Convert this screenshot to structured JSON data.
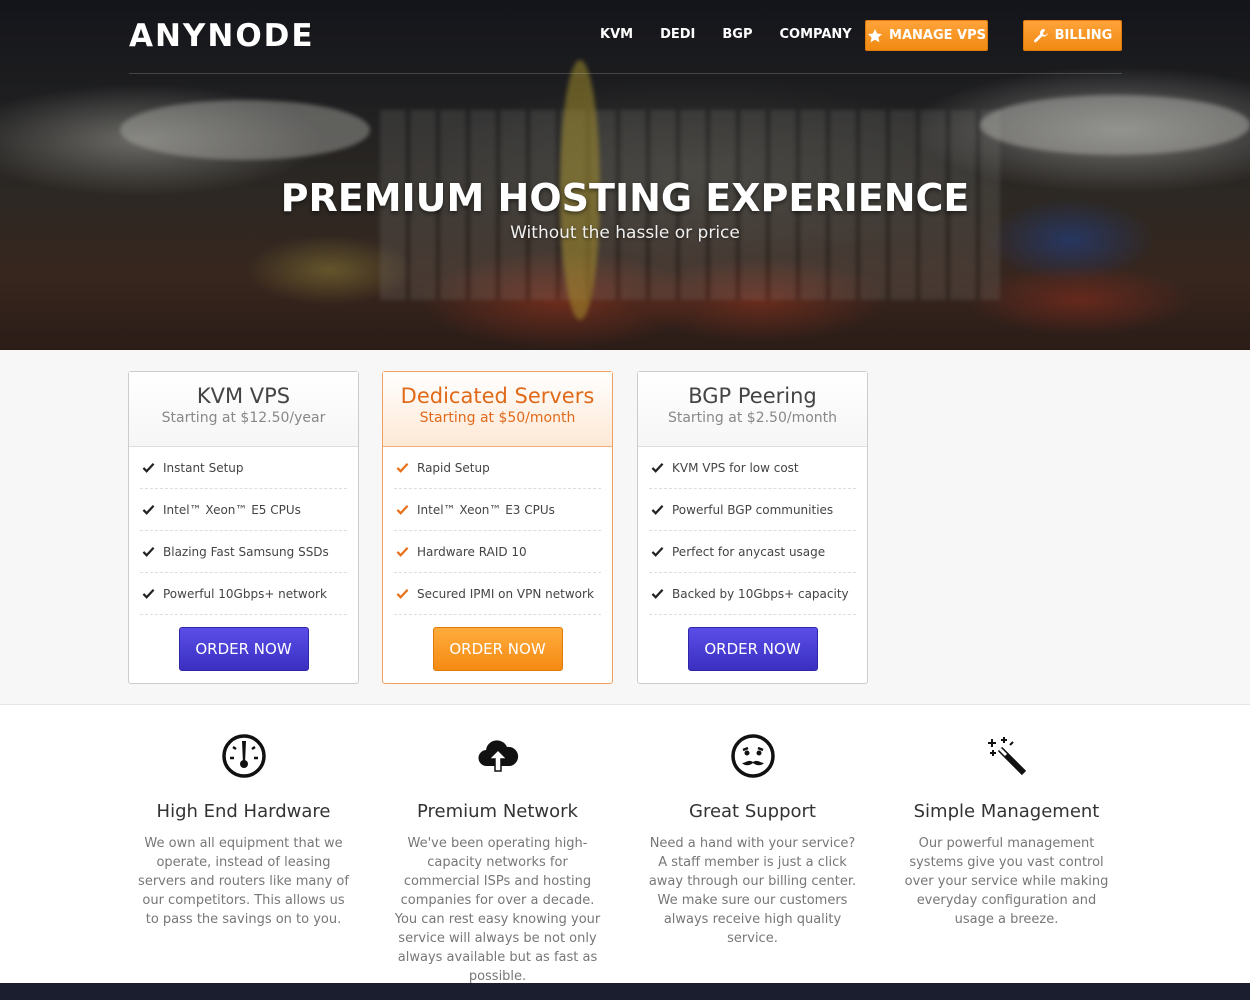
{
  "header": {
    "logo": "ANYNODE",
    "nav": [
      "KVM",
      "DEDI",
      "BGP",
      "COMPANY"
    ],
    "manage_vps_label": "MANAGE VPS",
    "billing_label": "BILLING"
  },
  "hero": {
    "title": "PREMIUM HOSTING EXPERIENCE",
    "subtitle": "Without the hassle or price"
  },
  "plans": [
    {
      "name": "KVM VPS",
      "price": "Starting at $12.50/year",
      "features": [
        "Instant Setup",
        "Intel™ Xeon™ E5 CPUs",
        "Blazing Fast Samsung SSDs",
        "Powerful 10Gbps+ network"
      ],
      "cta": "ORDER NOW"
    },
    {
      "name": "Dedicated Servers",
      "price": "Starting at $50/month",
      "features": [
        "Rapid Setup",
        "Intel™ Xeon™ E3 CPUs",
        "Hardware RAID 10",
        "Secured IPMI on VPN network"
      ],
      "cta": "ORDER NOW"
    },
    {
      "name": "BGP Peering",
      "price": "Starting at $2.50/month",
      "features": [
        "KVM VPS for low cost",
        "Powerful BGP communities",
        "Perfect for anycast usage",
        "Backed by 10Gbps+ capacity"
      ],
      "cta": "ORDER NOW"
    }
  ],
  "features": [
    {
      "icon": "gauge-icon",
      "title": "High End Hardware",
      "desc": "We own all equipment that we operate, instead of leasing servers and routers like many of our competitors. This allows us to pass the savings on to you."
    },
    {
      "icon": "cloud-upload-icon",
      "title": "Premium Network",
      "desc": "We've been operating high-capacity networks for commercial ISPs and hosting companies for over a decade. You can rest easy knowing your service will always be not only always available but as fast as possible."
    },
    {
      "icon": "smiley-mustache-icon",
      "title": "Great Support",
      "desc": "Need a hand with your service? A staff member is just a click away through our billing center. We make sure our customers always receive high quality service."
    },
    {
      "icon": "magic-wand-icon",
      "title": "Simple Management",
      "desc": "Our powerful management systems give you vast control over your service while making everyday configuration and usage a breeze."
    }
  ],
  "colors": {
    "accent_orange": "#f58a14",
    "accent_purple": "#3a2fc0",
    "footer": "#1b1e2e"
  }
}
